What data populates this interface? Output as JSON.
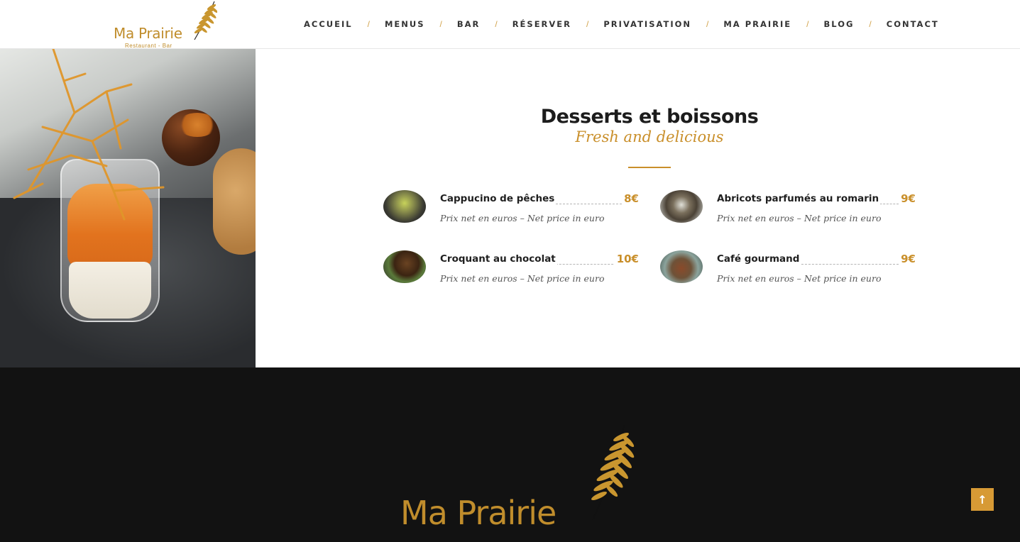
{
  "header": {
    "logo_text": "Ma Prairie",
    "logo_subtitle": "Restaurant - Bar",
    "nav": [
      {
        "label": "ACCUEIL"
      },
      {
        "label": "MENUS"
      },
      {
        "label": "BAR"
      },
      {
        "label": "RÉSERVER"
      },
      {
        "label": "PRIVATISATION"
      },
      {
        "label": "MA PRAIRIE"
      },
      {
        "label": "BLOG"
      },
      {
        "label": "CONTACT"
      }
    ],
    "nav_separator": "/"
  },
  "section": {
    "title": "Desserts et boissons",
    "subtitle": "Fresh and delicious",
    "items": [
      {
        "name": "Cappucino de pêches",
        "price": "8€",
        "description": "Prix net en euros – Net price in euro"
      },
      {
        "name": "Abricots parfumés au romarin",
        "price": "9€",
        "description": "Prix net en euros – Net price in euro"
      },
      {
        "name": "Croquant au chocolat",
        "price": "10€",
        "description": "Prix net en euros – Net price in euro"
      },
      {
        "name": "Café gourmand",
        "price": "9€",
        "description": "Prix net en euros – Net price in euro"
      }
    ]
  },
  "footer": {
    "logo_text": "Ma Prairie"
  },
  "back_to_top": {
    "icon": "arrow-up-icon",
    "glyph": "↑"
  },
  "colors": {
    "accent": "#c98f2a",
    "footer_bg": "#121212",
    "back_to_top_bg": "#d79a35"
  }
}
